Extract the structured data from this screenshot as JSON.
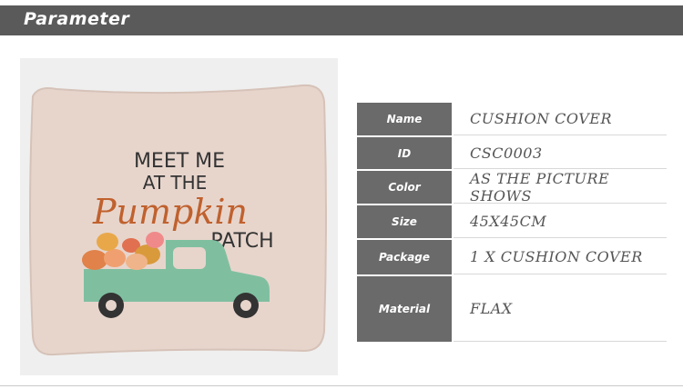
{
  "header": {
    "title": "Parameter"
  },
  "product_image": {
    "description_text": [
      "MEET ME",
      "AT THE",
      "Pumpkin",
      "PATCH"
    ]
  },
  "parameters": [
    {
      "label": "Name",
      "value": "CUSHION COVER"
    },
    {
      "label": "ID",
      "value": "CSC0003"
    },
    {
      "label": "Color",
      "value": "AS THE PICTURE SHOWS"
    },
    {
      "label": "Size",
      "value": "45X45CM"
    },
    {
      "label": "Package",
      "value": "1 X CUSHION COVER"
    },
    {
      "label": "Material",
      "value": "FLAX"
    }
  ],
  "colors": {
    "header_bg": "#5a5a5a",
    "label_bg": "#6a6a6a",
    "truck": "#7fbfa0",
    "pumpkin_text": "#c0612e"
  }
}
